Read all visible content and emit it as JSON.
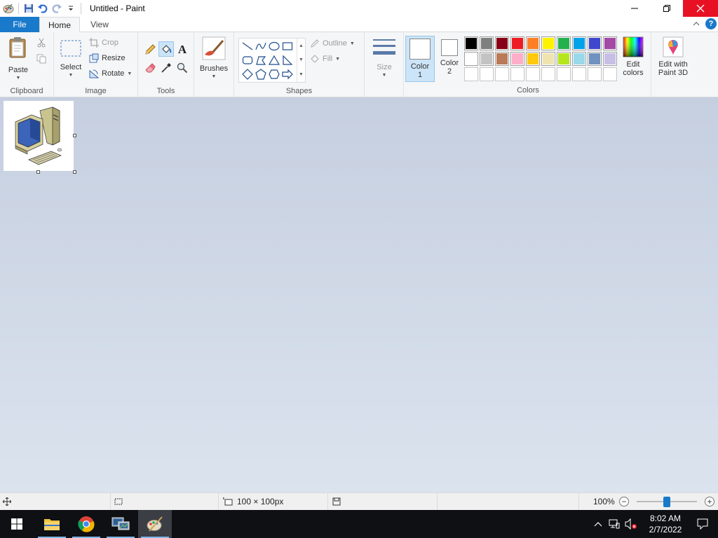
{
  "window": {
    "title": "Untitled - Paint"
  },
  "tabs": {
    "file": "File",
    "home": "Home",
    "view": "View"
  },
  "ribbon": {
    "clipboard": {
      "label": "Clipboard",
      "paste": "Paste"
    },
    "image": {
      "label": "Image",
      "select": "Select",
      "crop": "Crop",
      "resize": "Resize",
      "rotate": "Rotate"
    },
    "tools": {
      "label": "Tools"
    },
    "brushes": {
      "label": "Brushes"
    },
    "shapes": {
      "label": "Shapes",
      "outline": "Outline",
      "fill": "Fill"
    },
    "size": {
      "label": "Size"
    },
    "colors": {
      "label": "Colors",
      "color1_line1": "Color",
      "color1_line2": "1",
      "color2_line1": "Color",
      "color2_line2": "2",
      "edit_line1": "Edit",
      "edit_line2": "colors",
      "paint3d_line1": "Edit with",
      "paint3d_line2": "Paint 3D",
      "palette_row1": [
        "#000000",
        "#7f7f7f",
        "#880015",
        "#ed1c24",
        "#ff7f27",
        "#fff200",
        "#22b14c",
        "#00a2e8",
        "#3f48cc",
        "#a349a4"
      ],
      "palette_row2": [
        "#ffffff",
        "#c3c3c3",
        "#b97a57",
        "#ffaec9",
        "#ffc90e",
        "#efe4b0",
        "#b5e61d",
        "#99d9ea",
        "#7092be",
        "#c8bfe7"
      ]
    }
  },
  "status": {
    "image_size": "100 × 100px",
    "zoom": "100%",
    "zoom_fraction": 0.5
  },
  "taskbar": {
    "time": "8:02 AM",
    "date": "2/7/2022"
  }
}
